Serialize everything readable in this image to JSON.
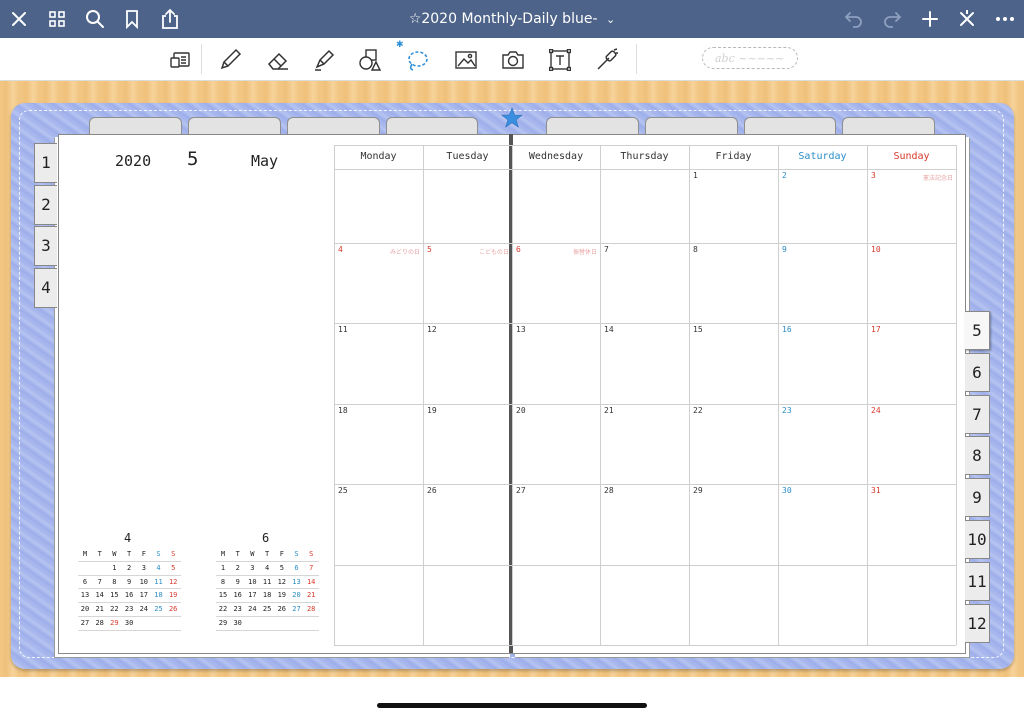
{
  "app": {
    "title": "☆2020 Monthly-Daily blue-",
    "title_chevron": "⌄",
    "colors": {
      "titlebar": "#4d6389",
      "binder": "#a9b9ee",
      "saturday": "#2a8ec7",
      "sunday": "#d8392b"
    },
    "nav_icons": [
      "close-icon",
      "grid-icon",
      "search-icon",
      "bookmark-icon",
      "share-icon"
    ],
    "right_icons": [
      "undo-icon",
      "redo-icon",
      "add-icon",
      "close-x-icon",
      "more-icon"
    ]
  },
  "toolbar": {
    "tools": [
      "keyboard-tool-icon",
      "pen-icon",
      "eraser-icon",
      "highlighter-icon",
      "shapes-icon",
      "lasso-icon",
      "image-icon",
      "camera-icon",
      "text-box-icon",
      "laser-icon"
    ],
    "bluetooth_label": "✱",
    "handwriting_placeholder": "abc ~~~~~"
  },
  "month_header": {
    "year": "2020",
    "month_number": "5",
    "month_name": "May"
  },
  "left_tabs": [
    "1",
    "2",
    "3",
    "4"
  ],
  "right_tabs": [
    "5",
    "6",
    "7",
    "8",
    "9",
    "10",
    "11",
    "12"
  ],
  "active_tab": "5",
  "weekdays": [
    "Monday",
    "Tuesday",
    "Wednesday",
    "Thursday",
    "Friday",
    "Saturday",
    "Sunday"
  ],
  "weeks": [
    [
      "",
      "",
      "",
      "",
      "1",
      "2",
      "3"
    ],
    [
      "4",
      "5",
      "6",
      "7",
      "8",
      "9",
      "10"
    ],
    [
      "11",
      "12",
      "13",
      "14",
      "15",
      "16",
      "17"
    ],
    [
      "18",
      "19",
      "20",
      "21",
      "22",
      "23",
      "24"
    ],
    [
      "25",
      "26",
      "27",
      "28",
      "29",
      "30",
      "31"
    ],
    [
      "",
      "",
      "",
      "",
      "",
      "",
      ""
    ]
  ],
  "holidays": [
    {
      "week": 0,
      "day": 6,
      "label": "憲法記念日"
    },
    {
      "week": 1,
      "day": 0,
      "label": "みどりの日"
    },
    {
      "week": 1,
      "day": 1,
      "label": "こどもの日"
    },
    {
      "week": 1,
      "day": 2,
      "label": "振替休日"
    }
  ],
  "red_days": [
    [
      0,
      6
    ],
    [
      1,
      0
    ],
    [
      1,
      1
    ],
    [
      1,
      2
    ],
    [
      1,
      6
    ],
    [
      2,
      6
    ],
    [
      3,
      6
    ],
    [
      4,
      6
    ]
  ],
  "mini_calendars": [
    {
      "title": "4",
      "weekdays": [
        "M",
        "T",
        "W",
        "T",
        "F",
        "S",
        "S"
      ],
      "weeks": [
        [
          "",
          "",
          "1",
          "2",
          "3",
          "4",
          "5"
        ],
        [
          "6",
          "7",
          "8",
          "9",
          "10",
          "11",
          "12"
        ],
        [
          "13",
          "14",
          "15",
          "16",
          "17",
          "18",
          "19"
        ],
        [
          "20",
          "21",
          "22",
          "23",
          "24",
          "25",
          "26"
        ],
        [
          "27",
          "28",
          "29",
          "30",
          "",
          "",
          ""
        ]
      ],
      "red": [
        [
          4,
          2
        ]
      ]
    },
    {
      "title": "6",
      "weekdays": [
        "M",
        "T",
        "W",
        "T",
        "F",
        "S",
        "S"
      ],
      "weeks": [
        [
          "1",
          "2",
          "3",
          "4",
          "5",
          "6",
          "7"
        ],
        [
          "8",
          "9",
          "10",
          "11",
          "12",
          "13",
          "14"
        ],
        [
          "15",
          "16",
          "17",
          "18",
          "19",
          "20",
          "21"
        ],
        [
          "22",
          "23",
          "24",
          "25",
          "26",
          "27",
          "28"
        ],
        [
          "29",
          "30",
          "",
          "",
          "",
          "",
          ""
        ]
      ],
      "red": []
    }
  ]
}
